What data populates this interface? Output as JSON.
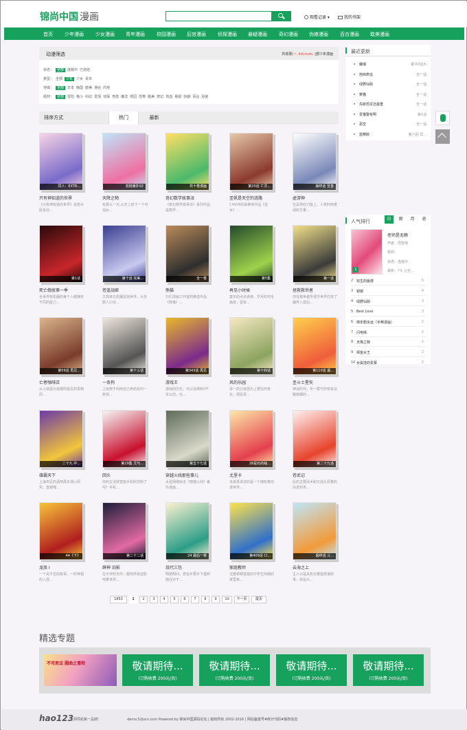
{
  "header": {
    "logo_part1": "锦尚中国",
    "logo_part2": "漫画",
    "search_placeholder": "",
    "history_label": "观看记录",
    "bookshelf_label": "我的书架"
  },
  "nav": [
    "首页",
    "少年漫画",
    "少女漫画",
    "青年漫画",
    "校园漫画",
    "后宫漫画",
    "侦探漫画",
    "悬疑漫画",
    "奇幻漫画",
    "伪娘漫画",
    "百合漫画",
    "耽美漫画"
  ],
  "filter": {
    "title": "动漫筛选",
    "count_prefix": "共收录",
    "count_value": "[~..list;num..]",
    "count_suffix": "部少年漫画",
    "rows": [
      {
        "label": "状态：",
        "options": [
          "全部",
          "连载中",
          "已完结"
        ],
        "selected": 0
      },
      {
        "label": "类型：",
        "options": [
          "全部",
          "少年",
          "少女",
          "青年"
        ],
        "selected": 1
      },
      {
        "label": "地域：",
        "options": [
          "全部",
          "日本",
          "韩国",
          "欧美",
          "港台",
          "内地"
        ],
        "selected": 0
      },
      {
        "label": "题材：",
        "options": [
          "全部",
          "冒险",
          "格斗",
          "科幻",
          "爱情",
          "侦探",
          "竞技",
          "魔法",
          "校园",
          "恐怖",
          "耽美",
          "奇幻",
          "热血",
          "悬疑",
          "伪娘",
          "百合",
          "后宫"
        ],
        "selected": 0
      }
    ]
  },
  "sort_tabs": {
    "label": "排序方式",
    "hot": "热门",
    "new": "最新"
  },
  "comics": [
    {
      "title": "只有神知道的世界",
      "desc": "《只有神知道的世界》是若木民喜创...",
      "badge": "同人：EXTR..."
    },
    {
      "title": "天降之物",
      "desc": "有那么一天,从天上掉下一个可怕女...",
      "badge": "完结番外02"
    },
    {
      "title": "奇幻数学故事派",
      "desc": "《奇幻数学故事派》系列作品是数学...",
      "badge": "共十卷漫画"
    },
    {
      "title": "圣帆是天空的涟路",
      "desc": "CHIIYA的最佛得作品《星女》...",
      "badge": "第20话 亡灵..."
    },
    {
      "title": "虚游神",
      "desc": "在具界的力能上，人类利用宽阔的方量...",
      "badge": "最终话 至善"
    },
    {
      "title": "死亡假故第一季",
      "desc": "全世界有机器的每个人都拥有不同的能力...",
      "badge": "第1话"
    },
    {
      "title": "苍蓝战姬",
      "desc": "文现来在机器是抱世界，大多数人口也...",
      "badge": "第十话 完美..."
    },
    {
      "title": "熊猫",
      "desc": "只们漫画工作室的精选作品《熊猫》...",
      "badge": "全一卷"
    },
    {
      "title": "再见小时候",
      "desc": "童年的点点滴滴，岁月的鸡毛蒜皮，留有...",
      "badge": "第5集"
    },
    {
      "title": "拯救救世者",
      "desc": "前任救世者所谓守世界打败了魔界入侵后...",
      "badge": "第一话"
    },
    {
      "title": "亡者咖啡店",
      "desc": "从小就因为自眼所能见的事物而...",
      "badge": "第59话 再见..."
    },
    {
      "title": "一条狗",
      "desc": "上班族于利用自己养的名叫一条狗...",
      "badge": "第十三话"
    },
    {
      "title": "游戏王",
      "desc": "游戏的历史，可以追溯到3千年以前，在...",
      "badge": "第343话 再见"
    },
    {
      "title": "风的乐园",
      "desc": "泽一的父亲因为上要在阿普东，把后母...",
      "badge": "第十四话"
    },
    {
      "title": "圣斗士星矢",
      "desc": "神话时代，专一群守护有象征雅典娜的...",
      "badge": "第110话 最..."
    },
    {
      "title": "雄霸天下",
      "desc": "上海市区的酒吧再年漫心研究，直被哩...",
      "badge": "二十九 中..."
    },
    {
      "title": "回头",
      "desc": "你的生活突智能手机所控制了吗？手机...",
      "badge": "第29集 尤与..."
    },
    {
      "title": "穿越火线那些事儿",
      "desc": "大型网络射击《穿越火线》番外漫画...",
      "badge": "第五十七话"
    },
    {
      "title": "尤里卡",
      "desc": "本故事讲述的是一个拥有着动漫世界...",
      "badge": "28是石的秘..."
    },
    {
      "title": "苍武记",
      "desc": "后的主要武术和又强头厚着的白发的男...",
      "badge": "第二十九话"
    },
    {
      "title": "龙族 I",
      "desc": "一个关于龙的故事。一时神祖的入侵...",
      "badge": "44《下》"
    },
    {
      "title": "薛神 旧影",
      "desc": "在不伴时光中，都特界有迎影响着世界...",
      "badge": "第二十二话"
    },
    {
      "title": "烧代三包",
      "desc": "明丽明间，意包乡要乡下遇到她在对于...",
      "badge": "24 最后一章"
    },
    {
      "title": "家庭教师",
      "desc": "过着顿顿悠悠的中学生阿纲的家里来...",
      "badge": "第409话 Cl..."
    },
    {
      "title": "云海之上",
      "desc": "主人公是具有无量首部谁的事，就是大...",
      "badge": "最终话 三..."
    }
  ],
  "pagination": [
    "1853",
    "1",
    "2",
    "3",
    "4",
    "5",
    "6",
    "7",
    "8",
    "9",
    "10",
    "下一页",
    "尾页"
  ],
  "recent": {
    "title": "最近更新",
    "items": [
      {
        "name": "魔瑞",
        "status": "第 63话大"
      },
      {
        "name": "芭郎疯虫",
        "status": "全一话"
      },
      {
        "name": "绿野仙踪",
        "status": "全一话"
      },
      {
        "name": "菜猫",
        "status": "全一话"
      },
      {
        "name": "先斯恐龙还最重",
        "status": "全一话"
      },
      {
        "name": "爱猫警有明",
        "status": "第1话"
      },
      {
        "name": "恶空",
        "status": "全一话"
      },
      {
        "name": "蓝精踪",
        "status": "第六回 异..."
      }
    ]
  },
  "ranking": {
    "title": "人气排行",
    "tabs": [
      "日",
      "周",
      "月",
      "总"
    ],
    "top": {
      "name": "老师是无赖",
      "author": "作者：周智瑶",
      "genre": "题材：",
      "status": "状态：连载中",
      "rating": "最新：?%  让全…"
    },
    "items": [
      {
        "name": "双生的蜃楼",
        "count": "5"
      },
      {
        "name": "钥镜",
        "count": "4"
      },
      {
        "name": "绿野仙踪",
        "count": "3"
      },
      {
        "name": "Best Love",
        "count": "3"
      },
      {
        "name": "柿年剧永远（手粹漫画）",
        "count": "2"
      },
      {
        "name": "闪电晴",
        "count": "2"
      },
      {
        "name": "天降之物",
        "count": "2"
      },
      {
        "name": "拜金女王",
        "count": "2"
      },
      {
        "name": "女属挂的爱慕",
        "count": "2"
      }
    ]
  },
  "special": {
    "title": "精选专题",
    "banner_text": "不可思议 圆曲之冒险",
    "item_title": "敬请期待...",
    "item_sub": "(订购收费 200元/页)"
  },
  "footer": {
    "logo": "hao123",
    "slogan": "上网导航第一品牌!",
    "copy": "demo.52jscn.com Powered by 锦尚中国源码论坛 | 版权所有 2002-2016 | 网站备案号#统计代码#版权信息"
  },
  "colors": {
    "brand": "#16a15c",
    "accent_red": "#e33333"
  }
}
